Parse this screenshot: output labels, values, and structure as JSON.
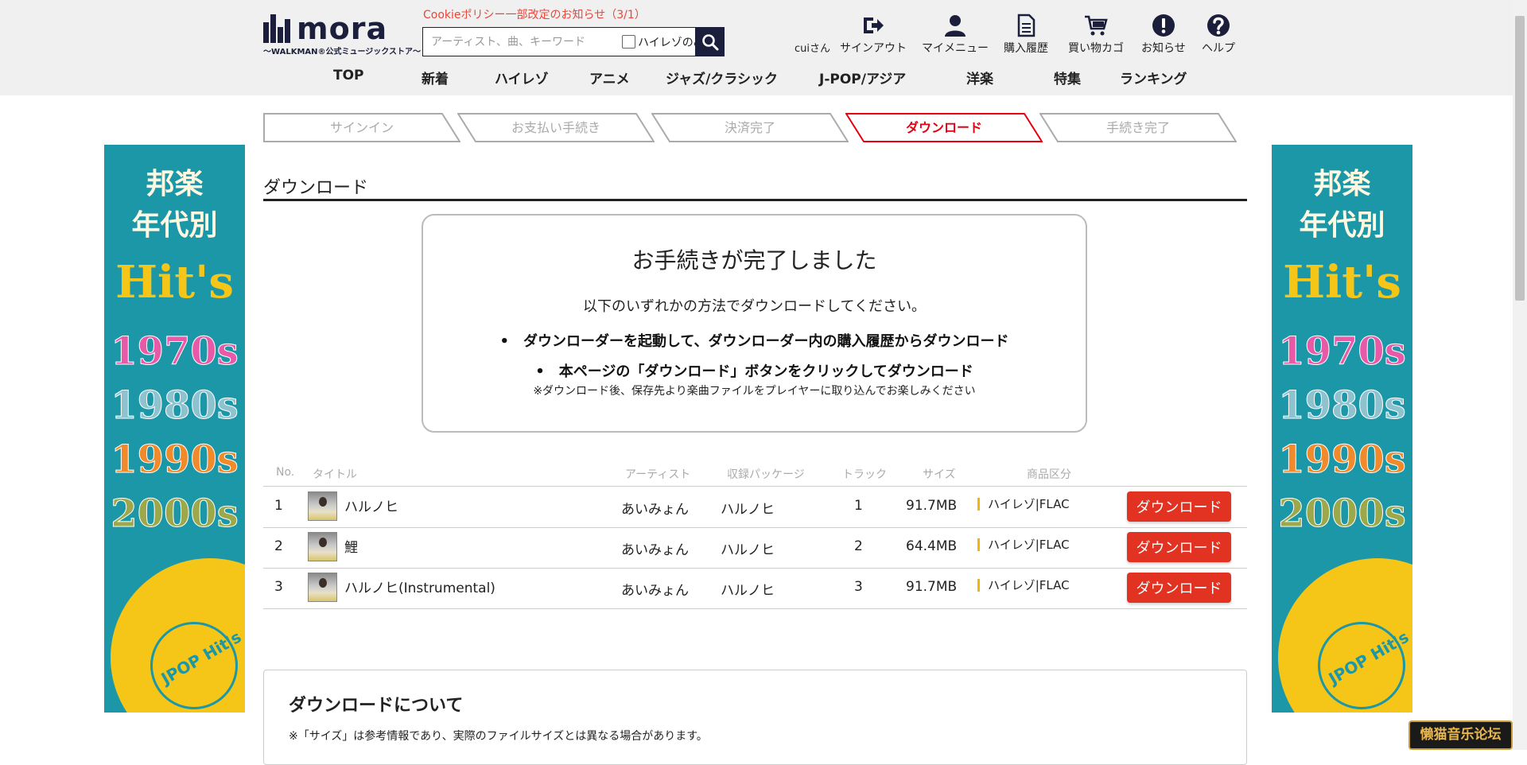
{
  "header": {
    "logo": {
      "text": "mora",
      "subtitle": "〜WALKMAN®公式ミュージックストア〜"
    },
    "cookie_notice": "Cookieポリシー一部改定のお知らせ（3/1）",
    "search": {
      "placeholder": "アーティスト、曲、キーワード",
      "hires_label": "ハイレゾのみ"
    },
    "user_name": "cuiさん",
    "icons": [
      {
        "label": "サインアウト",
        "icon": "signout-icon"
      },
      {
        "label": "マイメニュー",
        "icon": "person-icon"
      },
      {
        "label": "購入履歴",
        "icon": "document-icon"
      },
      {
        "label": "買い物カゴ",
        "icon": "cart-icon"
      },
      {
        "label": "お知らせ",
        "icon": "alert-icon"
      },
      {
        "label": "ヘルプ",
        "icon": "help-icon"
      }
    ],
    "nav": [
      "TOP",
      "新着",
      "ハイレゾ",
      "アニメ",
      "ジャズ/クラシック",
      "J-POP/アジア",
      "洋楽",
      "特集",
      "ランキング"
    ]
  },
  "steps": [
    {
      "label": "サインイン",
      "active": false
    },
    {
      "label": "お支払い手続き",
      "active": false
    },
    {
      "label": "決済完了",
      "active": false
    },
    {
      "label": "ダウンロード",
      "active": true
    },
    {
      "label": "手続き完了",
      "active": false
    }
  ],
  "banner": {
    "line1": "邦楽",
    "line2": "年代別",
    "line3": "Hit's",
    "decades": [
      "1970s",
      "1980s",
      "1990s",
      "2000s"
    ],
    "disc_label": "JPOP Hit's",
    "decade_colors": [
      "#e85aa8",
      "#8fc2cf",
      "#f08a2a",
      "#9ca84a"
    ]
  },
  "page": {
    "title": "ダウンロード",
    "done_heading": "お手続きが完了しました",
    "done_sub": "以下のいずれかの方法でダウンロードしてください。",
    "methods": [
      "ダウンローダーを起動して、ダウンローダー内の購入履歴からダウンロード",
      "本ページの「ダウンロード」ボタンをクリックしてダウンロード"
    ],
    "note": "※ダウンロード後、保存先より楽曲ファイルをプレイヤーに取り込んでお楽しみください"
  },
  "table": {
    "headers": {
      "no": "No.",
      "title": "タイトル",
      "artist": "アーティスト",
      "package": "収録パッケージ",
      "track": "トラック",
      "size": "サイズ",
      "type": "商品区分"
    },
    "download_label": "ダウンロード",
    "rows": [
      {
        "no": "1",
        "title": "ハルノヒ",
        "artist": "あいみょん",
        "package": "ハルノヒ",
        "track": "1",
        "size": "91.7MB",
        "spec": "ハイレゾ|FLAC"
      },
      {
        "no": "2",
        "title": "鯉",
        "artist": "あいみょん",
        "package": "ハルノヒ",
        "track": "2",
        "size": "64.4MB",
        "spec": "ハイレゾ|FLAC"
      },
      {
        "no": "3",
        "title": "ハルノヒ(Instrumental)",
        "artist": "あいみょん",
        "package": "ハルノヒ",
        "track": "3",
        "size": "91.7MB",
        "spec": "ハイレゾ|FLAC"
      }
    ]
  },
  "about": {
    "title": "ダウンロードについて",
    "note": "※「サイズ」は参考情報であり、実際のファイルサイズとは異なる場合があります。"
  },
  "watermark": "懒猫音乐论坛",
  "colors": {
    "accent_red": "#e23222",
    "nav_dark": "#1b1f3b",
    "banner_teal": "#1b97a8",
    "banner_yellow": "#f5c518"
  }
}
